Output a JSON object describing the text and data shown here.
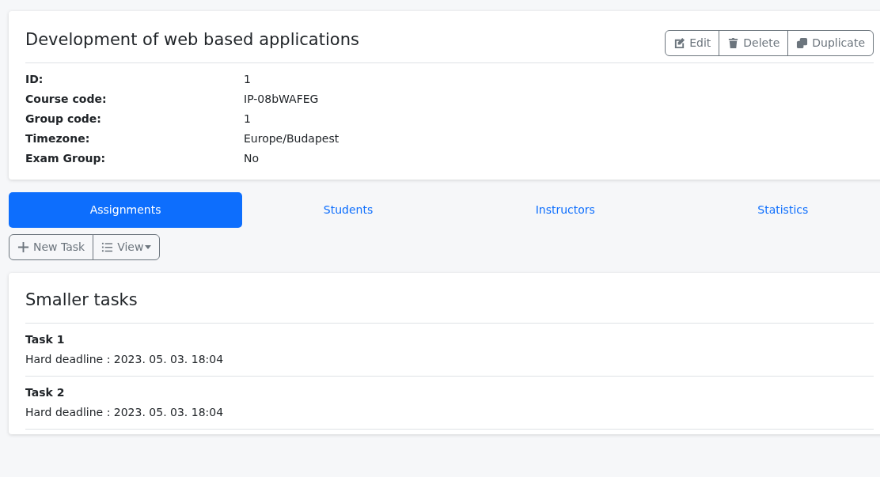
{
  "course": {
    "title": "Development of web based applications",
    "actions": [
      {
        "kind": "edit",
        "label": "Edit"
      },
      {
        "kind": "delete",
        "label": "Delete"
      },
      {
        "kind": "duplicate",
        "label": "Duplicate"
      }
    ],
    "details": [
      {
        "label": "ID:",
        "value": "1"
      },
      {
        "label": "Course code:",
        "value": "IP-08bWAFEG"
      },
      {
        "label": "Group code:",
        "value": "1"
      },
      {
        "label": "Timezone:",
        "value": "Europe/Budapest"
      },
      {
        "label": "Exam Group:",
        "value": "No"
      }
    ]
  },
  "tabs": [
    {
      "label": "Assignments",
      "selected": true
    },
    {
      "label": "Students",
      "selected": false
    },
    {
      "label": "Instructors",
      "selected": false
    },
    {
      "label": "Statistics",
      "selected": false
    }
  ],
  "toolbar": [
    {
      "kind": "add",
      "label": "New Task"
    },
    {
      "kind": "view",
      "label": "View"
    }
  ],
  "task_group": {
    "title": "Smaller tasks",
    "tasks": [
      {
        "name": "Task 1",
        "deadline": "Hard deadline : 2023. 05. 03. 18:04"
      },
      {
        "name": "Task 2",
        "deadline": "Hard deadline : 2023. 05. 03. 18:04"
      }
    ]
  }
}
